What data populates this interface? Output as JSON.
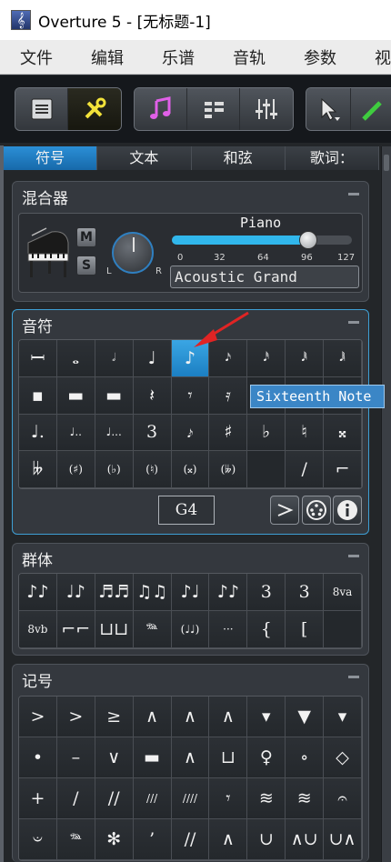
{
  "window": {
    "title": "Overture 5 - [无标题-1]"
  },
  "menu": [
    "文件",
    "编辑",
    "乐谱",
    "音轨",
    "参数",
    "视"
  ],
  "tabs": [
    "符号",
    "文本",
    "和弦",
    "歌词："
  ],
  "mixer": {
    "title": "混合器",
    "mute": "M",
    "solo": "S",
    "pan_left": "L",
    "pan_right": "R",
    "instrument": "Piano",
    "volume_ticks": [
      "0",
      "32",
      "64",
      "96",
      "127"
    ],
    "volume_level": 0.76,
    "patch": "Acoustic Grand"
  },
  "notes": {
    "title": "音符",
    "row1": [
      "𝄩",
      "𝅝",
      "𝅗𝅥",
      "♩",
      "♪",
      "𝅘𝅥𝅯",
      "𝅘𝅥𝅰",
      "𝅘𝅥𝅱",
      "𝅘𝅥𝅲"
    ],
    "row2": [
      "▪",
      "▬",
      "▬",
      "𝄽",
      "𝄾",
      "𝄿",
      "",
      "",
      ""
    ],
    "row3": [
      "♩.",
      "♩..",
      "♩...",
      "3",
      "𝆔",
      "♯",
      "♭",
      "♮",
      "𝄪"
    ],
    "row4": [
      "𝄫",
      "(♯)",
      "(♭)",
      "(♮)",
      "(𝄪)",
      "(𝄫)",
      "",
      "/",
      "⌐"
    ],
    "pitch": "G4",
    "tooltip": "Sixteenth Note"
  },
  "tuplets": {
    "title": "群体",
    "row1": [
      "♪♪",
      "♩♪",
      "♬♬",
      "♫♫",
      "♪♩",
      "♪♪",
      "3",
      "3",
      "8va"
    ],
    "row2": [
      "8vb",
      "⌐⌐",
      "⊔⊔",
      "𝆮",
      "(♩♩)",
      "···",
      "{",
      "[",
      ""
    ]
  },
  "marks": {
    "title": "记号",
    "row1": [
      ">",
      ">",
      "≥",
      "∧",
      "∧",
      "∧",
      "▾",
      "▼",
      "▾"
    ],
    "row2": [
      "•",
      "–",
      "∨",
      "▬",
      "∧",
      "⊔",
      "♀",
      "∘",
      "◇"
    ],
    "row3": [
      "+",
      "/",
      "//",
      "///",
      "////",
      "𝄾",
      "≋",
      "≋",
      "𝄐"
    ],
    "row4": [
      "𝄑",
      "𝆮",
      "✻",
      "’",
      "//",
      "∧",
      "∪",
      "∧∪",
      "∪∧"
    ]
  }
}
